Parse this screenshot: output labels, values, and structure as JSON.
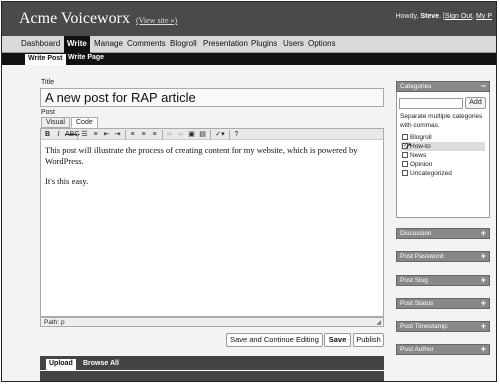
{
  "header": {
    "site_title": "Acme Voiceworx",
    "view_site": "(View site »)",
    "howdy_prefix": "Howdy, ",
    "user": "Steve",
    "howdy_suffix": ". [",
    "sign_out": "Sign Out",
    "separator": ", ",
    "my_profile": "My P"
  },
  "menu": [
    "Dashboard",
    "Write",
    "Manage",
    "Comments",
    "Blogroll",
    "Presentation",
    "Plugins",
    "Users",
    "Options"
  ],
  "submenu": [
    "Write Post",
    "Write Page"
  ],
  "form": {
    "title_label": "Title",
    "title_value": "A new post for RAP article",
    "post_label": "Post",
    "tab_visual": "Visual",
    "tab_code": "Code",
    "body": [
      "This post will illustrate the process of creating content for my website, which is powered by WordPress.",
      "It's this easy."
    ],
    "path": "Path: p",
    "save_continue": "Save and Continue Editing",
    "save": "Save",
    "publish": "Publish",
    "upload_tab": "Upload",
    "browse_tab": "Browse All"
  },
  "toolbar_icons": [
    "bold-icon",
    "italic-icon",
    "strikethrough-icon",
    "bullet-list-icon",
    "numbered-list-icon",
    "outdent-icon",
    "indent-icon",
    "align-left-icon",
    "align-center-icon",
    "align-right-icon",
    "link-icon",
    "unlink-icon",
    "image-icon",
    "more-icon",
    "spellcheck-icon",
    "help-icon"
  ],
  "sidebar": {
    "categories_title": "Categories",
    "add_label": "Add",
    "help": "Separate multiple categories with commas.",
    "categories": [
      {
        "name": "Blogroll",
        "checked": false
      },
      {
        "name": "How-to",
        "checked": true
      },
      {
        "name": "News",
        "checked": false
      },
      {
        "name": "Opinion",
        "checked": false
      },
      {
        "name": "Uncategorized",
        "checked": false
      }
    ],
    "boxes": [
      "Discussion",
      "Post Password",
      "Post Slug",
      "Post Status",
      "Post Timestamp:",
      "Post Author"
    ],
    "collapse_symbol": "−",
    "expand_symbol": "+"
  }
}
